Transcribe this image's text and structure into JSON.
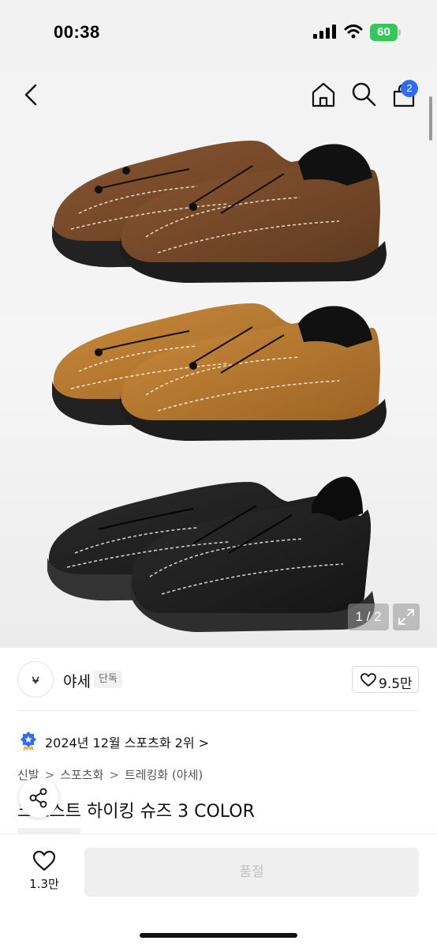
{
  "status_bar": {
    "time": "00:38",
    "battery": "60"
  },
  "nav": {
    "cart_count": "2"
  },
  "gallery": {
    "counter": "1 / 2"
  },
  "brand": {
    "logo_text": "⍱",
    "name": "야세",
    "badge": "단독",
    "likes": "9.5만"
  },
  "rank": {
    "text": "2024년 12월 스포츠화 2위 >"
  },
  "breadcrumb": [
    "신발",
    "스포츠화",
    "트레킹화 (야세)"
  ],
  "product": {
    "title": "크로스트 하이킹 슈즈 3 COLOR"
  },
  "bottom": {
    "wish_count": "1.3만",
    "buy_label": "품절"
  },
  "colors": {
    "accent": "#2f6df6",
    "battery": "#34c759",
    "shoe_brown": "#7a4a2a",
    "shoe_camel": "#b8782f",
    "shoe_black": "#1e1e1e"
  }
}
